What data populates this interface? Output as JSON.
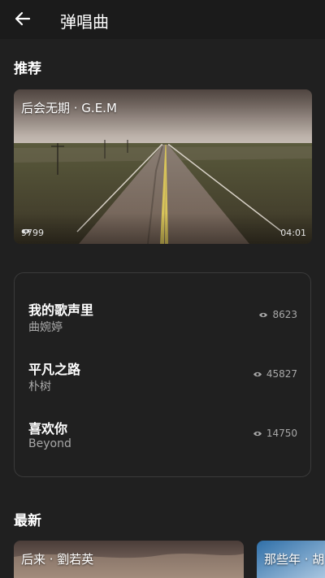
{
  "header": {
    "title": "弹唱曲"
  },
  "sections": {
    "recommended": "推荐",
    "latest": "最新"
  },
  "featured": {
    "title": "后会无期 · G.E.M",
    "views": "9799",
    "duration": "04:01"
  },
  "songs": [
    {
      "title": "我的歌声里",
      "artist": "曲婉婷",
      "views": "8623"
    },
    {
      "title": "平凡之路",
      "artist": "朴树",
      "views": "45827"
    },
    {
      "title": "喜欢你",
      "artist": "Beyond",
      "views": "14750"
    }
  ],
  "latest": [
    {
      "title": "后来 · 劉若英"
    },
    {
      "title": "那些年 · 胡"
    }
  ],
  "icons": {
    "back": "arrow-left-icon",
    "views": "eye-icon"
  }
}
